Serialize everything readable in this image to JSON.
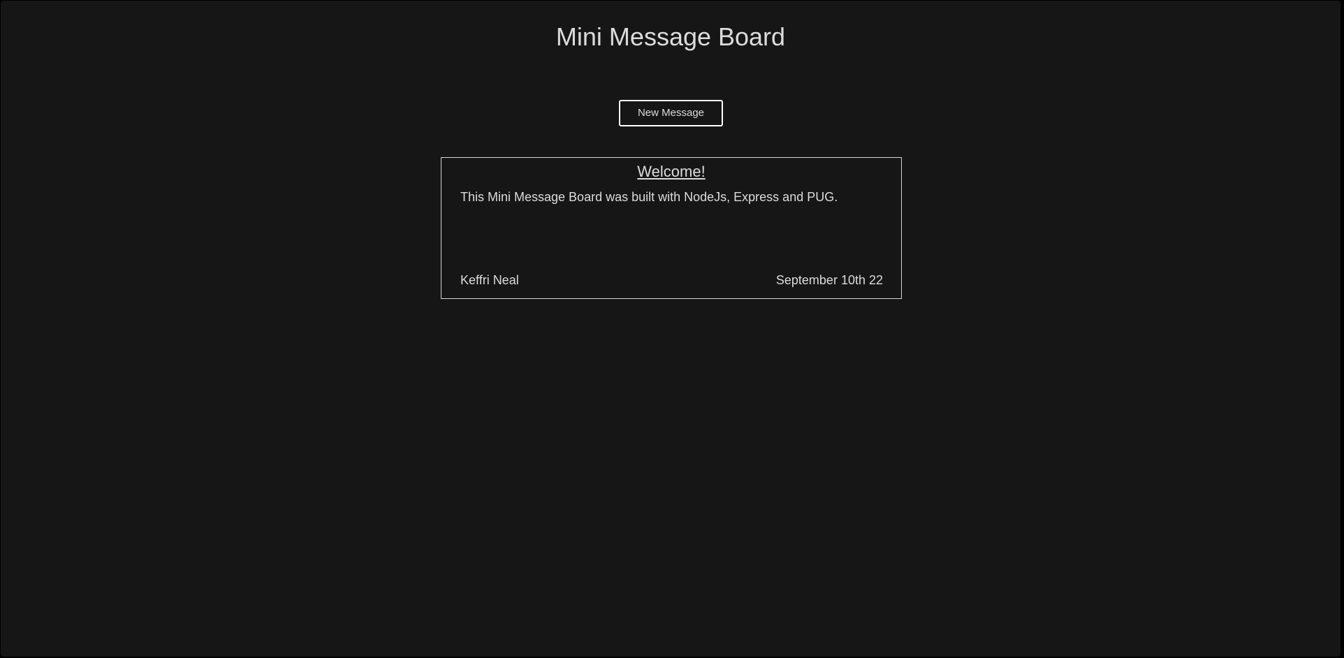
{
  "header": {
    "title": "Mini Message Board"
  },
  "actions": {
    "new_message_label": "New Message"
  },
  "messages": [
    {
      "title": "Welcome!",
      "body": "This Mini Message Board was built with NodeJs, Express and PUG.",
      "author": "Keffri Neal",
      "date": "September 10th 22"
    }
  ],
  "colors": {
    "background": "#161616",
    "text": "#dcdcdc",
    "border": "#ffffff"
  }
}
